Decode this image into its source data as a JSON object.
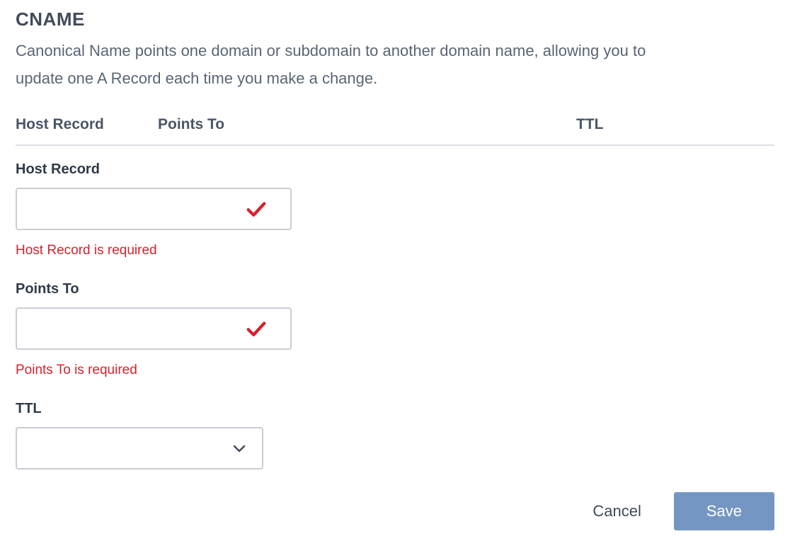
{
  "header": {
    "title": "CNAME",
    "description": "Canonical Name points one domain or subdomain to another domain name, allowing you to update one A Record each time you make a change."
  },
  "table_headers": {
    "host_record": "Host Record",
    "points_to": "Points To",
    "ttl": "TTL"
  },
  "fields": {
    "host_record": {
      "label": "Host Record",
      "value": "",
      "error": "Host Record is required"
    },
    "points_to": {
      "label": "Points To",
      "value": "",
      "error": "Points To is required"
    },
    "ttl": {
      "label": "TTL",
      "value": ""
    }
  },
  "buttons": {
    "cancel": "Cancel",
    "save": "Save"
  },
  "colors": {
    "error": "#d9212c",
    "primary_button": "#7596c2",
    "border": "#c9cdd3",
    "text": "#414b5a"
  }
}
